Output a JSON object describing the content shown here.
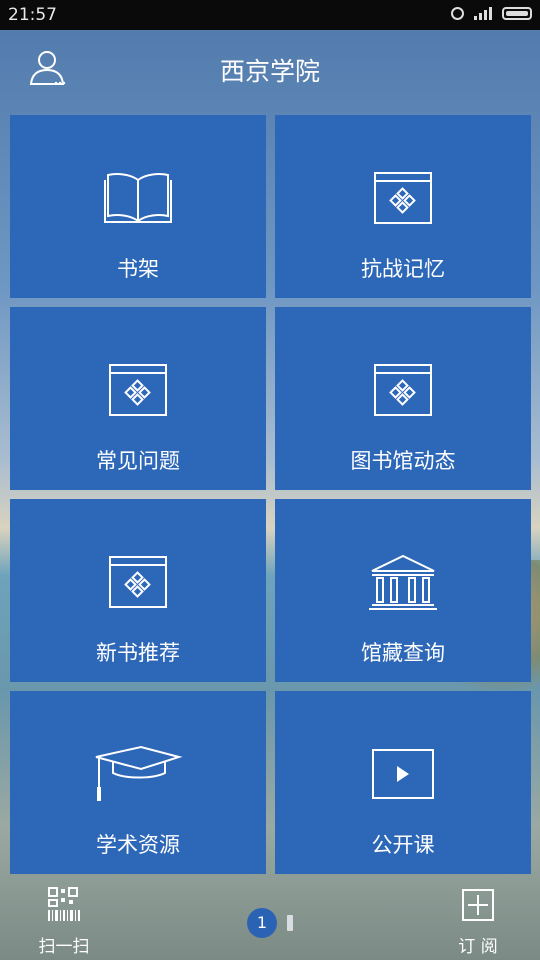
{
  "status_bar": {
    "time": "21:57"
  },
  "header": {
    "title": "西京学院"
  },
  "tiles": [
    {
      "label": "书架",
      "icon": "open-book-icon"
    },
    {
      "label": "抗战记忆",
      "icon": "app-window-icon"
    },
    {
      "label": "常见问题",
      "icon": "app-window-icon"
    },
    {
      "label": "图书馆动态",
      "icon": "app-window-icon"
    },
    {
      "label": "新书推荐",
      "icon": "app-window-icon"
    },
    {
      "label": "馆藏查询",
      "icon": "library-building-icon"
    },
    {
      "label": "学术资源",
      "icon": "graduation-cap-icon"
    },
    {
      "label": "公开课",
      "icon": "video-play-icon"
    }
  ],
  "bottom_bar": {
    "scan_label": "扫一扫",
    "subscribe_label": "订 阅",
    "current_page": "1"
  },
  "colors": {
    "tile": "#2d67b8",
    "page_indicator": "#2a63b3"
  }
}
